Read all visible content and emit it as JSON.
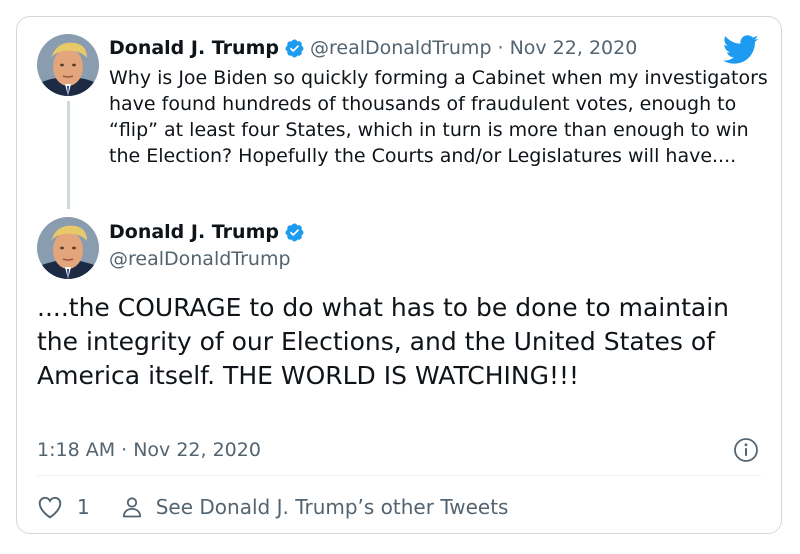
{
  "tweet1": {
    "author_name": "Donald J. Trump",
    "author_handle": "@realDonaldTrump",
    "separator": "·",
    "date": "Nov 22, 2020",
    "text": "Why is Joe Biden so quickly forming a Cabinet when my investigators have found hundreds of thousands of fraudulent votes, enough to “flip” at least four States, which in turn is more than enough to win the Election? Hopefully the Courts and/or Legislatures will have...."
  },
  "tweet2": {
    "author_name": "Donald J. Trump",
    "author_handle": "@realDonaldTrump",
    "text": "....the COURAGE to do what has to be done to maintain the integrity of our Elections,  and the United States of America itself. THE WORLD IS WATCHING!!!",
    "timestamp": "1:18 AM · Nov 22, 2020"
  },
  "footer": {
    "like_count": "1",
    "other_tweets_label": "See Donald J. Trump’s other Tweets"
  },
  "icons": {
    "brand": "twitter-bird-icon",
    "verified": "verified-badge-icon",
    "info": "info-icon",
    "like": "heart-icon",
    "profile": "person-icon"
  },
  "colors": {
    "twitter_blue": "#1d9bf0",
    "text_primary": "#0f1419",
    "text_secondary": "#536471",
    "border": "#cfd9de"
  }
}
